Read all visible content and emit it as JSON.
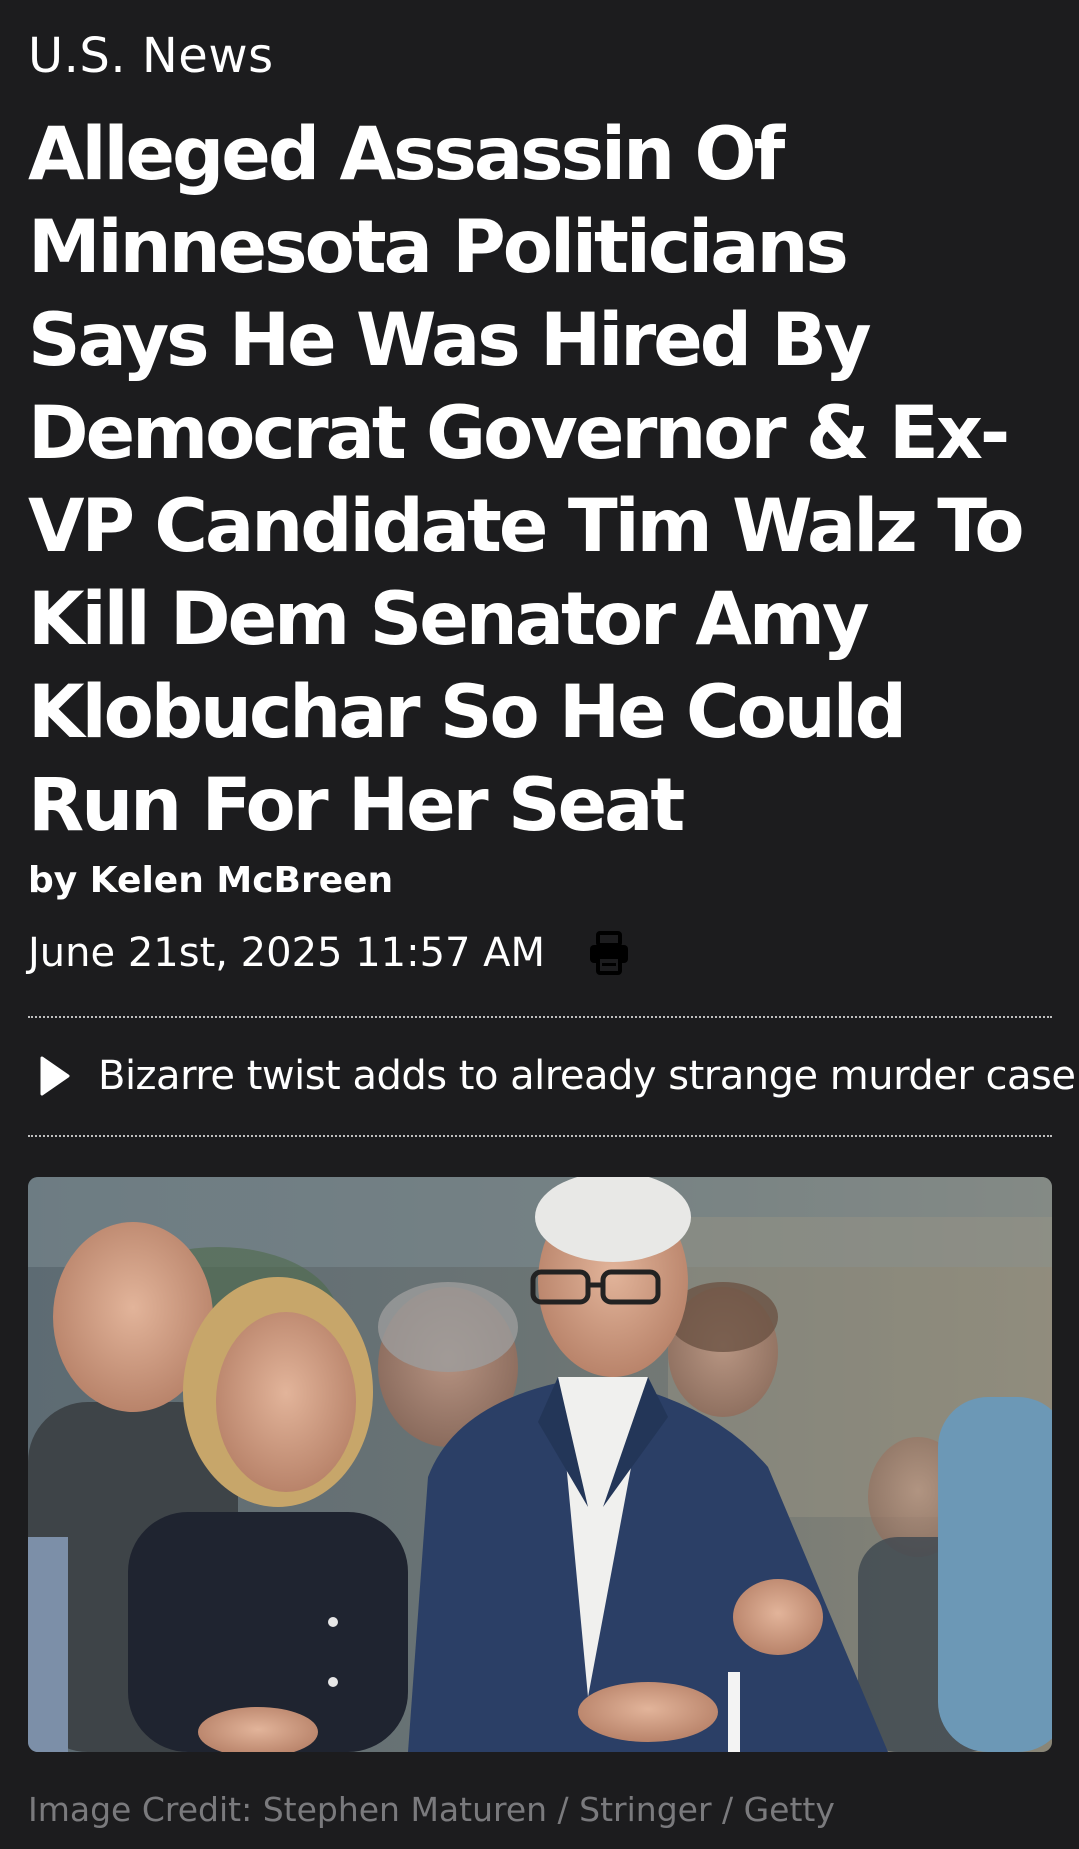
{
  "article": {
    "category": "U.S. News",
    "headline": "Alleged Assassin Of Minnesota Politicians Says He Was Hired By Democrat Governor & Ex-VP Candidate Tim Walz To Kill Dem Senator Amy Klobuchar So He Could Run For Her Seat",
    "byline": "by Kelen McBreen",
    "date": "June 21st, 2025 11:57 AM",
    "summary": "Bizarre twist adds to already strange murder case.",
    "image_credit": "Image Credit: Stephen Maturen / Stringer / Getty"
  },
  "icons": {
    "print": "print-icon",
    "summary_marker": "play-icon"
  },
  "colors": {
    "background": "#1c1c1e",
    "text": "#ffffff",
    "credit_text": "#7a7a7d",
    "rule": "#bfbfbf"
  }
}
